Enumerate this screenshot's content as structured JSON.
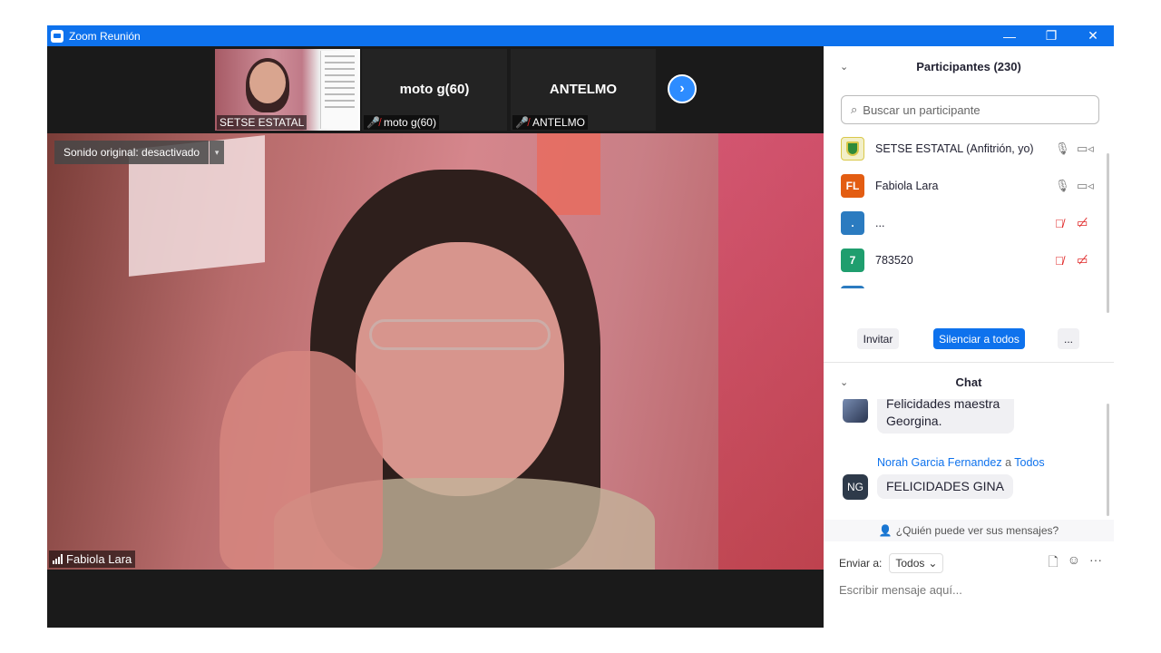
{
  "window": {
    "title": "Zoom Reunión",
    "minimize": "—",
    "restore": "❐",
    "close": "✕"
  },
  "thumbnails": [
    {
      "label": "SETSE ESTATAL",
      "big_name": "",
      "muted": false
    },
    {
      "label": "moto g(60)",
      "big_name": "moto g(60)",
      "muted": true
    },
    {
      "label": "ANTELMO",
      "big_name": "ANTELMO",
      "muted": true
    }
  ],
  "next_arrow": "›",
  "main_video": {
    "sound_badge": "Sonido original: desactivado",
    "sound_arrow": "▾",
    "speaker": "Fabiola Lara"
  },
  "participants": {
    "header": "Participantes (230)",
    "collapse": "⌄",
    "search_placeholder": "Buscar un participante",
    "search_icon": "⌕",
    "items": [
      {
        "name": "SETSE ESTATAL (Anfitrión, yo)",
        "avatar": "",
        "color": "#d9c84a",
        "mic": "on",
        "video": "on"
      },
      {
        "name": "Fabiola Lara",
        "avatar": "FL",
        "color": "#e35d12",
        "mic": "on",
        "video": "on"
      },
      {
        "name": "...",
        "avatar": ".",
        "color": "#2b7bc0",
        "mic": "off",
        "video": "off"
      },
      {
        "name": "783520",
        "avatar": "7",
        "color": "#1f9e6e",
        "mic": "off",
        "video": "off"
      },
      {
        "name": "",
        "avatar": "",
        "color": "#2b7bc0",
        "mic": "off",
        "video": "off"
      }
    ],
    "invite": "Invitar",
    "mute_all": "Silenciar a todos",
    "more": "..."
  },
  "chat": {
    "header": "Chat",
    "collapse": "⌄",
    "messages": [
      {
        "sender": "",
        "to": "",
        "text": "Felicidades maestra Georgina.",
        "avatar": ""
      },
      {
        "sender": "Norah Garcia Fernandez",
        "to_word": "a",
        "to": "Todos",
        "text": "FELICIDADES GINA",
        "avatar": "NG"
      }
    ],
    "who_sees": "¿Quién puede ver sus mensajes?",
    "send_to_label": "Enviar a:",
    "send_to_value": "Todos",
    "input_placeholder": "Escribir mensaje aquí...",
    "file_icon": "🗋",
    "emoji_icon": "☺",
    "more_icon": "···"
  },
  "colors": {
    "accent": "#0e72ed",
    "muted_red": "#e02828"
  }
}
